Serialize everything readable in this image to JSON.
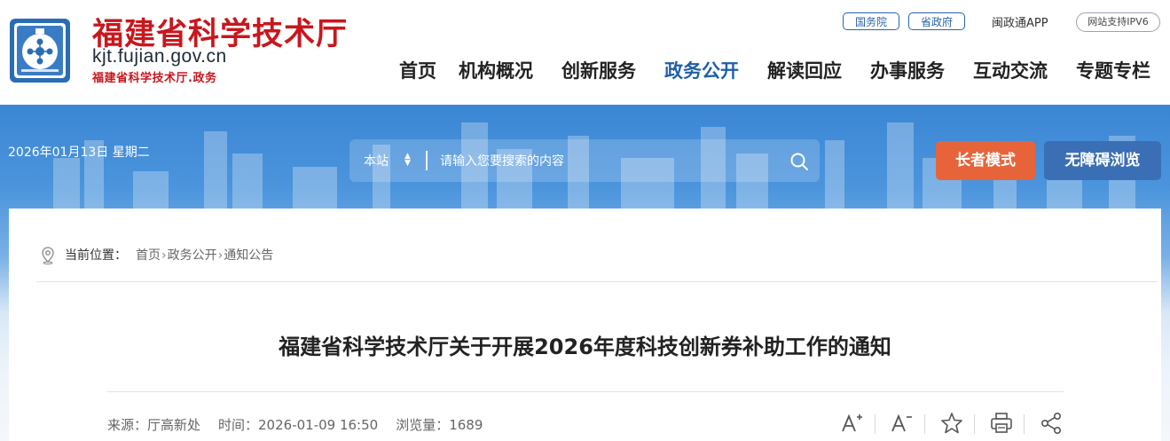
{
  "header": {
    "site_title": "福建省科学技术厅",
    "domain": "kjt.fujian.gov.cn",
    "sub_domain": "福建省科学技术厅.政务",
    "top_links": {
      "guowuyuan": "国务院",
      "shengzhengfu": "省政府"
    },
    "app_link": "闽政通APP",
    "ipv6_badge": "网站支持IPV6"
  },
  "nav": {
    "items": [
      {
        "label": "首页"
      },
      {
        "label": "机构概况"
      },
      {
        "label": "创新服务"
      },
      {
        "label": "政务公开"
      },
      {
        "label": "解读回应"
      },
      {
        "label": "办事服务"
      },
      {
        "label": "互动交流"
      },
      {
        "label": "专题专栏"
      }
    ],
    "active_index": 3
  },
  "banner": {
    "date": "2026年01月13日 星期二",
    "search": {
      "scope": "本站",
      "placeholder": "请输入您要搜索的内容"
    },
    "elder_mode": "长者模式",
    "accessibility": "无障碍浏览"
  },
  "breadcrumb": {
    "label": "当前位置：",
    "items": [
      "首页",
      "政务公开",
      "通知公告"
    ]
  },
  "article": {
    "title": "福建省科学技术厅关于开展2026年度科技创新券补助工作的通知",
    "source": "来源：厅高新处",
    "time": "时间：2026-01-09 16:50",
    "views": "浏览量：1689"
  },
  "tools": {
    "icons": [
      "font-increase-icon",
      "font-decrease-icon",
      "favorite-icon",
      "print-icon",
      "share-icon"
    ]
  },
  "colors": {
    "brand_red": "#c8171e",
    "nav_active": "#1f5ea8",
    "elder_button": "#e7643a",
    "access_button": "#3b6fb5"
  }
}
